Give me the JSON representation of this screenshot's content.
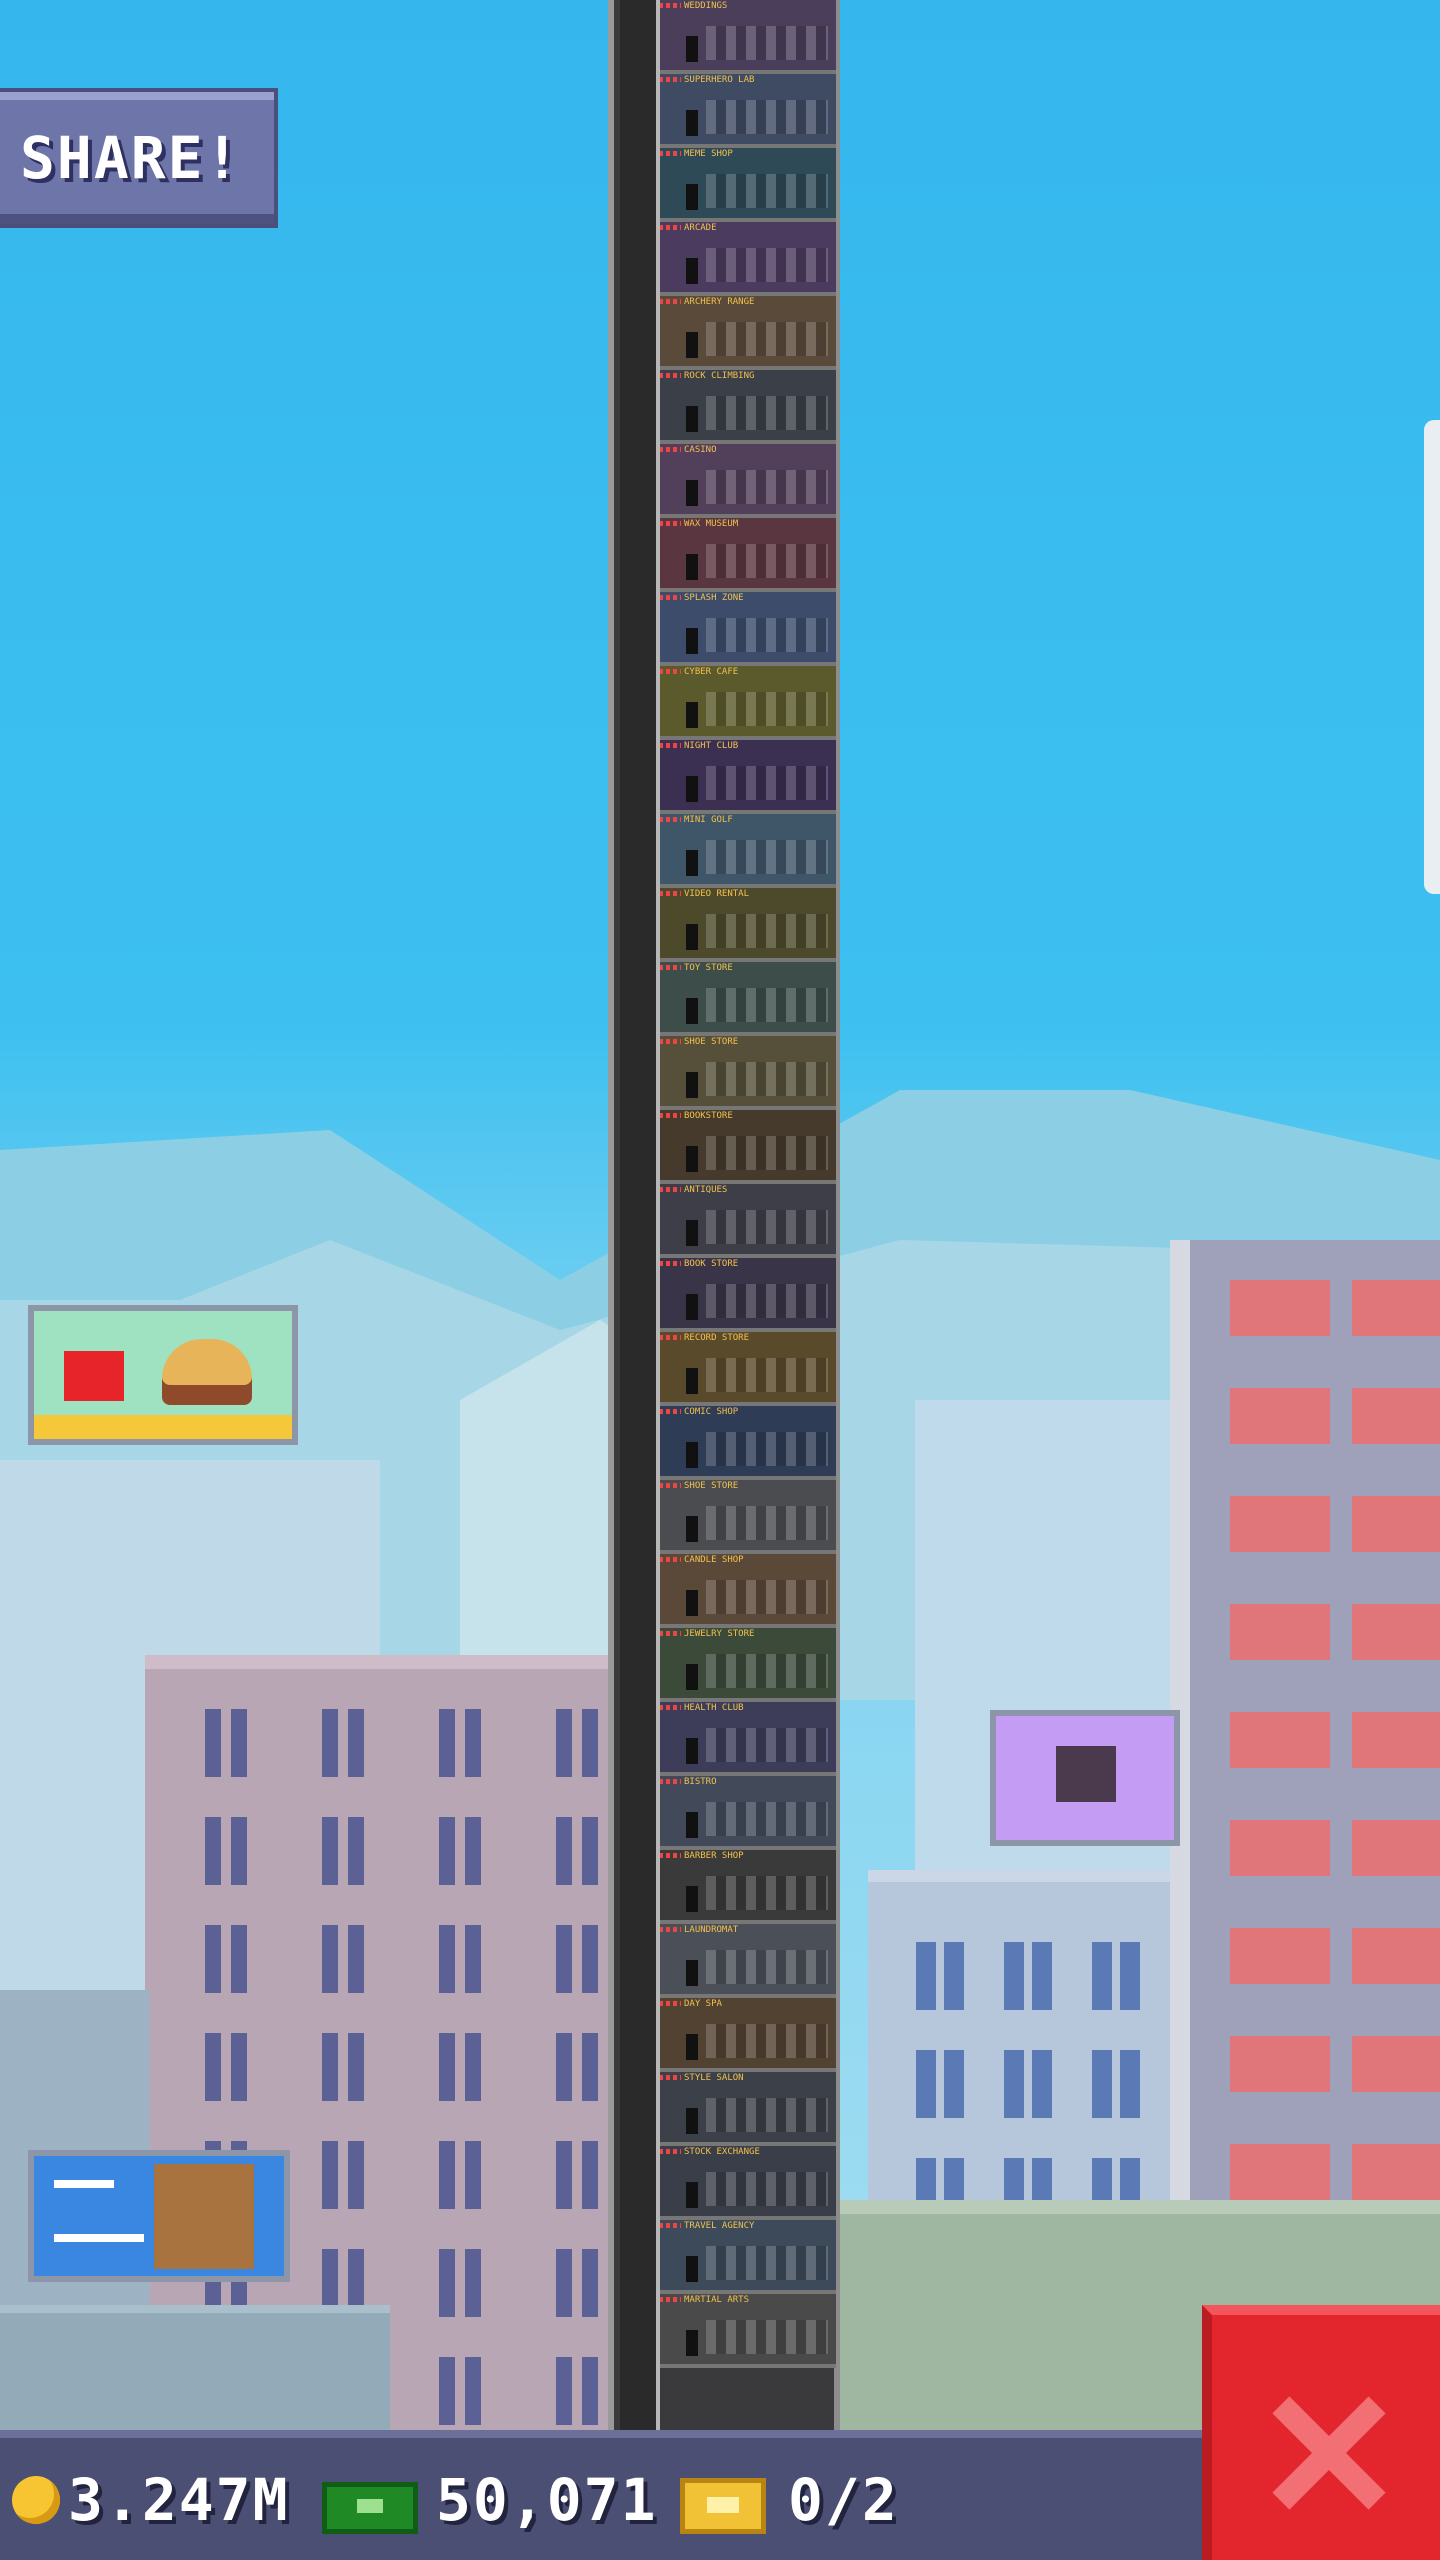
{
  "share_button": {
    "label": "SHARE!"
  },
  "floors": [
    {
      "name": "WEDDINGS"
    },
    {
      "name": "SUPERHERO LAB"
    },
    {
      "name": "MEME SHOP"
    },
    {
      "name": "ARCADE"
    },
    {
      "name": "ARCHERY RANGE"
    },
    {
      "name": "ROCK CLIMBING"
    },
    {
      "name": "CASINO"
    },
    {
      "name": "WAX MUSEUM"
    },
    {
      "name": "SPLASH ZONE"
    },
    {
      "name": "CYBER CAFE"
    },
    {
      "name": "NIGHT CLUB"
    },
    {
      "name": "MINI GOLF"
    },
    {
      "name": "VIDEO RENTAL"
    },
    {
      "name": "TOY STORE"
    },
    {
      "name": "SHOE STORE"
    },
    {
      "name": "BOOKSTORE"
    },
    {
      "name": "ANTIQUES"
    },
    {
      "name": "BOOK STORE"
    },
    {
      "name": "RECORD STORE"
    },
    {
      "name": "COMIC SHOP"
    },
    {
      "name": "SHOE STORE"
    },
    {
      "name": "CANDLE SHOP"
    },
    {
      "name": "JEWELRY STORE"
    },
    {
      "name": "HEALTH CLUB"
    },
    {
      "name": "BISTRO"
    },
    {
      "name": "BARBER SHOP"
    },
    {
      "name": "LAUNDROMAT"
    },
    {
      "name": "DAY SPA"
    },
    {
      "name": "STYLE SALON"
    },
    {
      "name": "STOCK EXCHANGE"
    },
    {
      "name": "TRAVEL AGENCY"
    },
    {
      "name": "MARTIAL ARTS"
    }
  ],
  "status_bar": {
    "coins": "3.247M",
    "bux": "50,071",
    "tickets": "0/2"
  },
  "icons": {
    "coin": "coin-icon",
    "bux": "bux-cash-icon",
    "ticket": "ticket-icon",
    "close": "close-icon"
  },
  "colors": {
    "sky": "#3bbdf0",
    "close_button": "#e3262d",
    "status_bar": "#4c4f74"
  }
}
